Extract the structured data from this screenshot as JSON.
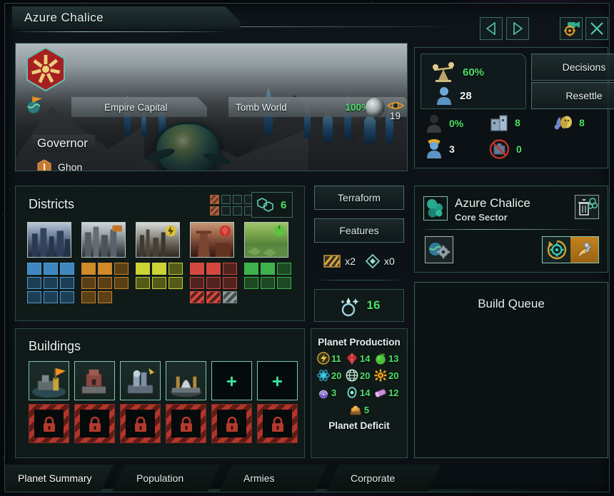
{
  "window": {
    "title": "Azure Chalice",
    "nav": {
      "prev": "previous-planet",
      "next": "next-planet",
      "locate": "locate-on-map",
      "close": "close"
    }
  },
  "planet_card": {
    "capital_tag": "Empire Capital",
    "class_tag": "Tomb World",
    "habitability": "100%",
    "size": "19",
    "governor_label": "Governor",
    "governor_name": "Ghon"
  },
  "pop_panel": {
    "stability": "60%",
    "pops": "28",
    "buttons": {
      "decisions": "Decisions",
      "resettle": "Resettle"
    },
    "stats": [
      {
        "icon": "crime-icon",
        "value": "0%",
        "color": "green"
      },
      {
        "icon": "housing-icon",
        "value": "8",
        "color": "green"
      },
      {
        "icon": "amenities-icon",
        "value": "8",
        "color": "green"
      },
      {
        "icon": "jobs-icon",
        "value": "3",
        "color": "white"
      },
      {
        "icon": "unemployed-icon",
        "value": "0",
        "color": "green"
      }
    ]
  },
  "districts": {
    "title": "Districts",
    "free_count": "6",
    "minigrid": [
      [
        "hatch",
        "empty",
        "empty",
        "empty"
      ],
      [
        "hatch",
        "empty",
        "empty",
        "empty"
      ]
    ],
    "columns": [
      {
        "name": "city-district",
        "blocks": [
          1,
          1,
          1,
          0,
          0,
          0,
          0,
          0,
          0
        ],
        "fill": "#3f87c2",
        "dim": "#1e3e56",
        "border": "#4f9ad4"
      },
      {
        "name": "industrial-district",
        "blocks": [
          1,
          1,
          0,
          0,
          0,
          0,
          0,
          0,
          -1
        ],
        "fill": "#d08a28",
        "dim": "#5b3f16",
        "border": "#c8832a"
      },
      {
        "name": "generator-district",
        "blocks": [
          1,
          1,
          0,
          0,
          0,
          0,
          -1,
          -1,
          -1
        ],
        "fill": "#cdd335",
        "dim": "#545a18",
        "border": "#c9cf37"
      },
      {
        "name": "mining-district",
        "blocks": [
          1,
          1,
          0,
          0,
          0,
          0,
          2,
          2,
          3
        ],
        "fill": "#d5483f",
        "dim": "#53221f",
        "border": "#cf4a40"
      },
      {
        "name": "agriculture-district",
        "blocks": [
          1,
          1,
          0,
          0,
          0,
          0,
          -1,
          -1,
          -1
        ],
        "fill": "#3eb24a",
        "dim": "#1d4a22",
        "border": "#3fb04b"
      }
    ]
  },
  "mid_column": {
    "terraform": "Terraform",
    "features": "Features",
    "feature_blockers": "x2",
    "feature_deposits": "x0",
    "amenities": "16"
  },
  "sector": {
    "name": "Azure Chalice",
    "subtitle": "Core Sector",
    "delete_icon": "delete-sector-icon",
    "automation_icon": "sector-automation-icon",
    "focus_icon": "sector-focus-icon",
    "build_icon": "sector-build-icon"
  },
  "build_queue": {
    "title": "Build Queue",
    "items": []
  },
  "buildings": {
    "title": "Buildings",
    "row1": [
      {
        "state": "filled",
        "name": "capital-building"
      },
      {
        "state": "filled",
        "name": "foundry-building"
      },
      {
        "state": "filled",
        "name": "research-lab-building"
      },
      {
        "state": "filled",
        "name": "refinery-building"
      },
      {
        "state": "empty",
        "name": "empty-slot",
        "glyph": "+"
      },
      {
        "state": "empty",
        "name": "empty-slot",
        "glyph": "+"
      }
    ],
    "row2": [
      {
        "state": "locked",
        "name": "locked-slot"
      },
      {
        "state": "locked",
        "name": "locked-slot"
      },
      {
        "state": "locked",
        "name": "locked-slot"
      },
      {
        "state": "locked",
        "name": "locked-slot"
      },
      {
        "state": "locked",
        "name": "locked-slot"
      },
      {
        "state": "locked",
        "name": "locked-slot"
      }
    ]
  },
  "production": {
    "title": "Planet Production",
    "deficit_title": "Planet Deficit",
    "items": [
      {
        "icon": "energy-icon",
        "value": "11"
      },
      {
        "icon": "minerals-icon",
        "value": "14"
      },
      {
        "icon": "food-icon",
        "value": "13"
      },
      {
        "icon": "physics-icon",
        "value": "20"
      },
      {
        "icon": "society-icon",
        "value": "20"
      },
      {
        "icon": "engineering-icon",
        "value": "20"
      },
      {
        "icon": "unity-icon",
        "value": "3"
      },
      {
        "icon": "trade-value-icon",
        "value": "14"
      },
      {
        "icon": "consumer-goods-icon",
        "value": "12"
      }
    ],
    "last": {
      "icon": "alloys-icon",
      "value": "5"
    }
  },
  "tabs": [
    {
      "label": "Planet Summary",
      "active": true
    },
    {
      "label": "Population",
      "active": false
    },
    {
      "label": "Armies",
      "active": false
    },
    {
      "label": "Corporate",
      "active": false
    }
  ],
  "colors": {
    "accent": "#4ee06a",
    "panel_border": "#2e5450",
    "panel_bg": "#101a18"
  }
}
